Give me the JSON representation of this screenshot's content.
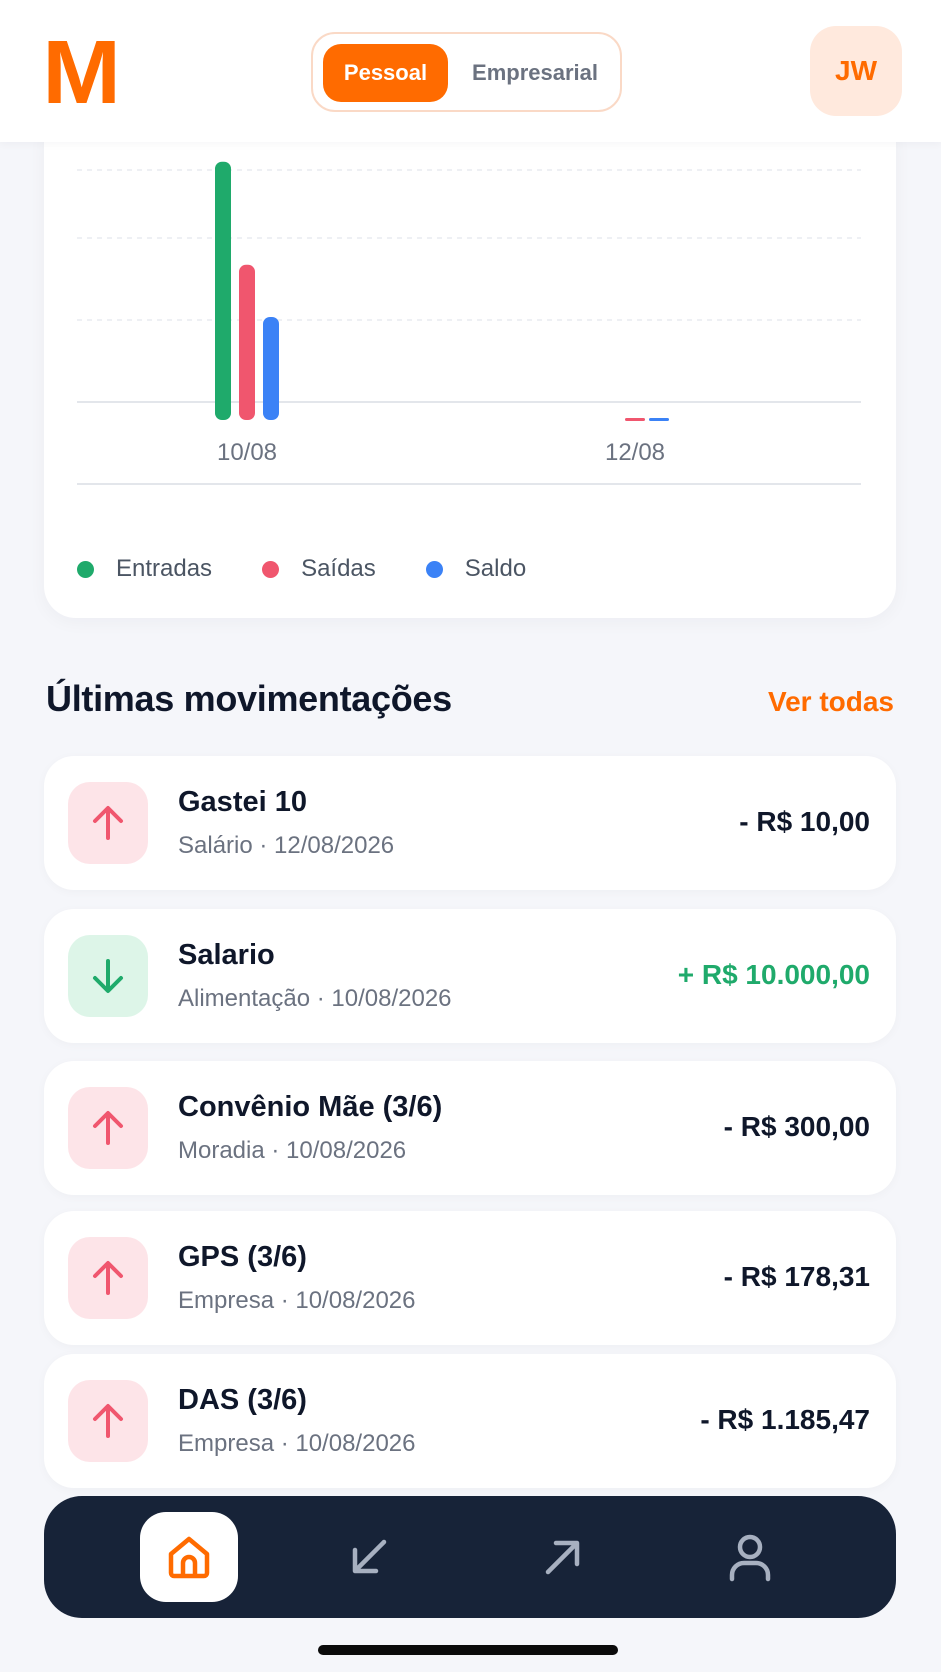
{
  "header": {
    "logo": "M",
    "segments": [
      "Pessoal",
      "Empresarial"
    ],
    "active_segment": "Pessoal",
    "avatar_initials": "JW"
  },
  "colors": {
    "brand": "#FF6B00",
    "entradas": "#1FAA6B",
    "saidas": "#F0566E",
    "saldo": "#3B82F6",
    "nav_bg": "#172338"
  },
  "chart_data": {
    "type": "bar",
    "categories": [
      "10/08",
      "12/08"
    ],
    "series": [
      {
        "name": "Entradas",
        "values": [
          10000,
          0
        ]
      },
      {
        "name": "Saídas",
        "values": [
          6010,
          10
        ]
      },
      {
        "name": "Saldo",
        "values": [
          3990,
          -10
        ]
      }
    ],
    "ylim": [
      0,
      10300
    ],
    "grid": true,
    "legend_position": "bottom"
  },
  "legend": {
    "entradas": "Entradas",
    "saidas": "Saídas",
    "saldo": "Saldo"
  },
  "section": {
    "title": "Últimas movimentações",
    "see_all": "Ver todas"
  },
  "transactions": [
    {
      "title": "Gastei 10",
      "subtitle": "Salário · 12/08/2026",
      "amount": "- R$ 10,00",
      "direction": "out",
      "icon": "arrow-up-icon"
    },
    {
      "title": "Salario",
      "subtitle": "Alimentação · 10/08/2026",
      "amount": "+ R$ 10.000,00",
      "direction": "in",
      "icon": "arrow-down-icon"
    },
    {
      "title": "Convênio Mãe (3/6)",
      "subtitle": "Moradia · 10/08/2026",
      "amount": "- R$ 300,00",
      "direction": "out",
      "icon": "arrow-up-icon"
    },
    {
      "title": "GPS (3/6)",
      "subtitle": "Empresa · 10/08/2026",
      "amount": "- R$ 178,31",
      "direction": "out",
      "icon": "arrow-up-icon"
    },
    {
      "title": "DAS (3/6)",
      "subtitle": "Empresa · 10/08/2026",
      "amount": "- R$ 1.185,47",
      "direction": "out",
      "icon": "arrow-up-icon"
    }
  ],
  "nav": {
    "items": [
      "home-icon",
      "arrow-down-left-icon",
      "arrow-up-right-icon",
      "user-icon"
    ],
    "active": "home-icon"
  }
}
